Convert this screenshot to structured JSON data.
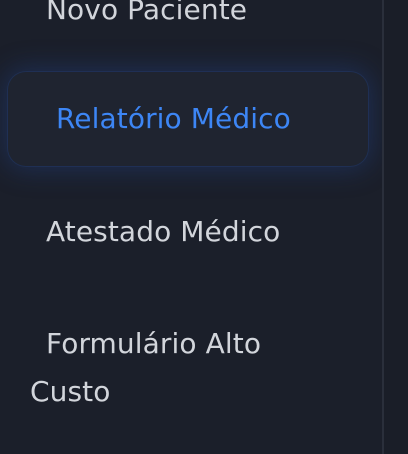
{
  "sidebar": {
    "items": [
      {
        "label": "Novo Paciente",
        "active": false
      },
      {
        "label": "Relatório Médico",
        "active": true
      },
      {
        "label": "Atestado Médico",
        "active": false
      },
      {
        "label": "Formulário Alto Custo",
        "active": false
      }
    ]
  },
  "colors": {
    "background": "#1b1f2a",
    "active_item_bg": "#1f2430",
    "active_text": "#3d86f5",
    "inactive_text": "#d2d5db",
    "divider": "#2a2f3b"
  }
}
